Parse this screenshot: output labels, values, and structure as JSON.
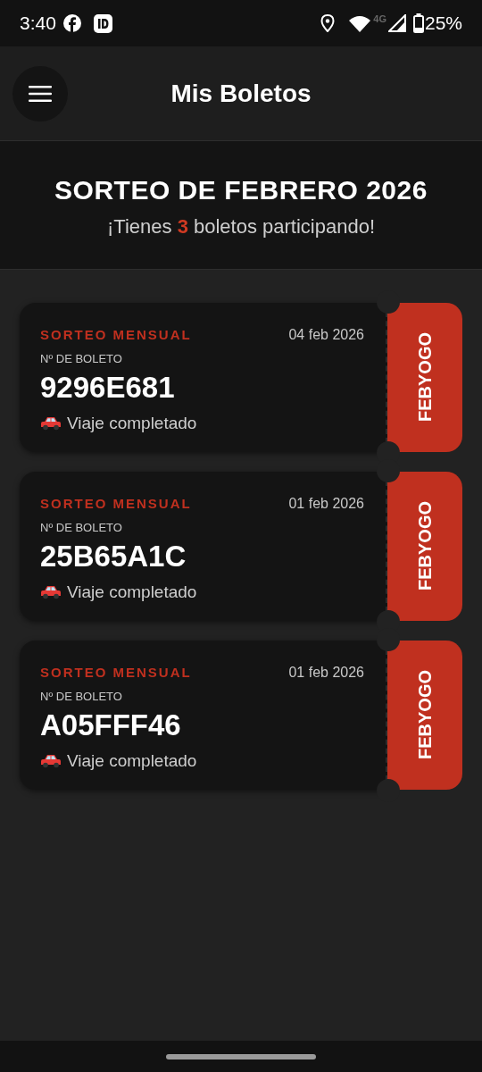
{
  "status_bar": {
    "time": "3:40",
    "network": "4G",
    "battery": "25%"
  },
  "header": {
    "title": "Mis Boletos"
  },
  "banner": {
    "title": "SORTEO DE FEBRERO 2026",
    "subtitle": "¡Tienes **3** boletos participando!"
  },
  "tickets": [
    {
      "category": "SORTEO MENSUAL",
      "date": "04 feb 2026",
      "number_label": "Nº DE BOLETO",
      "number": "9296E681",
      "status": "Viaje completado",
      "stub": "FEBYOGO"
    },
    {
      "category": "SORTEO MENSUAL",
      "date": "01 feb 2026",
      "number_label": "Nº DE BOLETO",
      "number": "25B65A1C",
      "status": "Viaje completado",
      "stub": "FEBYOGO"
    },
    {
      "category": "SORTEO MENSUAL",
      "date": "01 feb 2026",
      "number_label": "Nº DE BOLETO",
      "number": "A05FFF46",
      "status": "Viaje completado",
      "stub": "FEBYOGO"
    }
  ]
}
